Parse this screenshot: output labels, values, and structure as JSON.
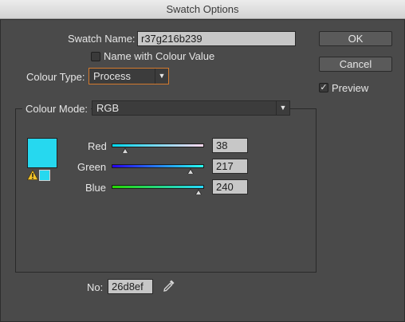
{
  "window": {
    "title": "Swatch Options"
  },
  "swatch_name": {
    "label": "Swatch Name:",
    "value": "r37g216b239"
  },
  "name_with_colour_value": {
    "label": "Name with Colour Value",
    "checked": false
  },
  "colour_type": {
    "label": "Colour Type:",
    "value": "Process"
  },
  "buttons": {
    "ok": "OK",
    "cancel": "Cancel"
  },
  "preview": {
    "label": "Preview",
    "checked": true
  },
  "colour_mode": {
    "label": "Colour Mode:",
    "value": "RGB"
  },
  "swatch_color": "#26d8ef",
  "channels": {
    "red": {
      "label": "Red",
      "value": "38",
      "fraction": 0.149
    },
    "green": {
      "label": "Green",
      "value": "217",
      "fraction": 0.851
    },
    "blue": {
      "label": "Blue",
      "value": "240",
      "fraction": 0.941
    }
  },
  "hex": {
    "label": "No:",
    "value": "26d8ef"
  },
  "icons": {
    "warning": "warning-icon",
    "eyedropper": "eyedropper-icon",
    "dropdown": "chevron-down-icon"
  }
}
